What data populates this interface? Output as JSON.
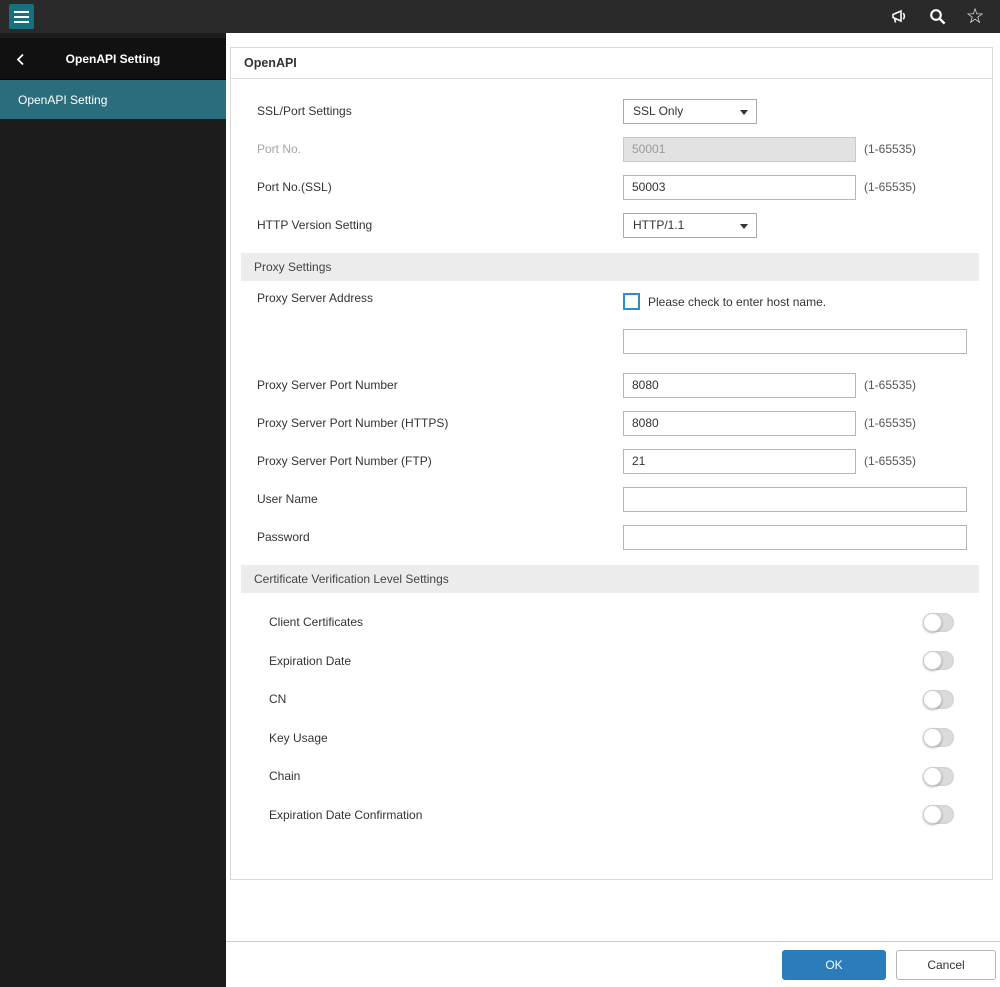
{
  "topbar": {
    "icons": {
      "menu": "hamburger-icon",
      "feedback": "megaphone-icon",
      "search": "search-icon",
      "favorite": "star-icon"
    }
  },
  "sidebar": {
    "title": "OpenAPI Setting",
    "items": [
      {
        "label": "OpenAPI Setting",
        "selected": true
      }
    ]
  },
  "page": {
    "title": "OpenAPI"
  },
  "ssl_section": {
    "rows": [
      {
        "label": "SSL/Port Settings",
        "value": "SSL Only"
      },
      {
        "label": "Port No.",
        "value": "50001",
        "hint": "(1-65535)",
        "disabled": true
      },
      {
        "label": "Port No.(SSL)",
        "value": "50003",
        "hint": "(1-65535)"
      },
      {
        "label": "HTTP Version Setting",
        "value": "HTTP/1.1"
      }
    ]
  },
  "proxy_section": {
    "title": "Proxy Settings",
    "address_label": "Proxy Server Address",
    "checkbox_label": "Please check to enter host name.",
    "address_value": "",
    "rows": [
      {
        "label": "Proxy Server Port Number",
        "value": "8080",
        "hint": "(1-65535)"
      },
      {
        "label": "Proxy Server Port Number (HTTPS)",
        "value": "8080",
        "hint": "(1-65535)"
      },
      {
        "label": "Proxy Server Port Number (FTP)",
        "value": "21",
        "hint": "(1-65535)"
      },
      {
        "label": "User Name",
        "value": ""
      },
      {
        "label": "Password",
        "value": ""
      }
    ]
  },
  "cert_section": {
    "title": "Certificate Verification Level Settings",
    "toggles": [
      {
        "label": "Client Certificates",
        "state": "off"
      },
      {
        "label": "Expiration Date",
        "state": "off"
      },
      {
        "label": "CN",
        "state": "off"
      },
      {
        "label": "Key Usage",
        "state": "off"
      },
      {
        "label": "Chain",
        "state": "off"
      },
      {
        "label": "Expiration Date Confirmation",
        "state": "off"
      }
    ]
  },
  "footer": {
    "ok_label": "OK",
    "cancel_label": "Cancel"
  },
  "colors": {
    "accent_teal": "#2a6d7c",
    "primary_button": "#2a7cba",
    "checkbox_border": "#2a8fc6",
    "topbar_bg": "#2a2a2a"
  }
}
